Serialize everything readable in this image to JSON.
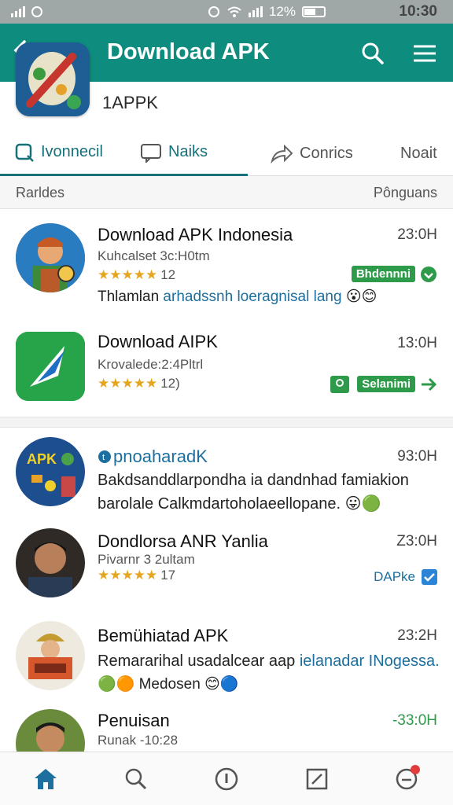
{
  "status": {
    "time": "10:30",
    "battery": "12%"
  },
  "header": {
    "title": "Download APK"
  },
  "app": {
    "name": "1APPK"
  },
  "tabs": [
    {
      "label": "Ivonnecil"
    },
    {
      "label": "Naiks"
    },
    {
      "label": "Conrics"
    },
    {
      "label": "Noait"
    }
  ],
  "sort": {
    "left": "Rarldes",
    "right": "Pônguans"
  },
  "items": [
    {
      "name": "Download APK Indonesia",
      "time": "23:0H",
      "meta": "Kuhcalset 3c:H0tm",
      "stars": "★★★★★",
      "count": "12",
      "badge": "Bhdennni",
      "message_a": "Thlamlan",
      "message_b": " arhadssnh loeragnisal lang"
    },
    {
      "name": "Download AIPK",
      "time": "13:0H",
      "meta": "Krovalede:2:4Pltrl",
      "stars": "★★★★★",
      "count": "12)",
      "badge": "Selanimi"
    },
    {
      "name": "pnoaharadK",
      "time": "93:0H",
      "message_a": "Bakdsanddlarpondha ia dandnhad famiakion",
      "message_b": "barolale Calkmdartoholaeellopane."
    },
    {
      "name": "Dondlorsa ANR Yanlia",
      "time": "Z3:0H",
      "meta": "Pivarnr 3 2ultam",
      "stars": "★★★★★",
      "count": "17",
      "badge": "DAPke"
    },
    {
      "name": "Bemühiatad APK",
      "time": "23:2H",
      "message_a": "Remararihal usadalcear aap ",
      "message_b": "ielanadar INogessa.",
      "message_c": "Medosen"
    },
    {
      "name": "Penuisan",
      "time": "-33:0H",
      "meta": "Runak -10:28"
    }
  ],
  "colors": {
    "teal": "#0e8c7e",
    "green": "#2e9b4a",
    "blue": "#1c6f9e",
    "star": "#e5a51e"
  }
}
